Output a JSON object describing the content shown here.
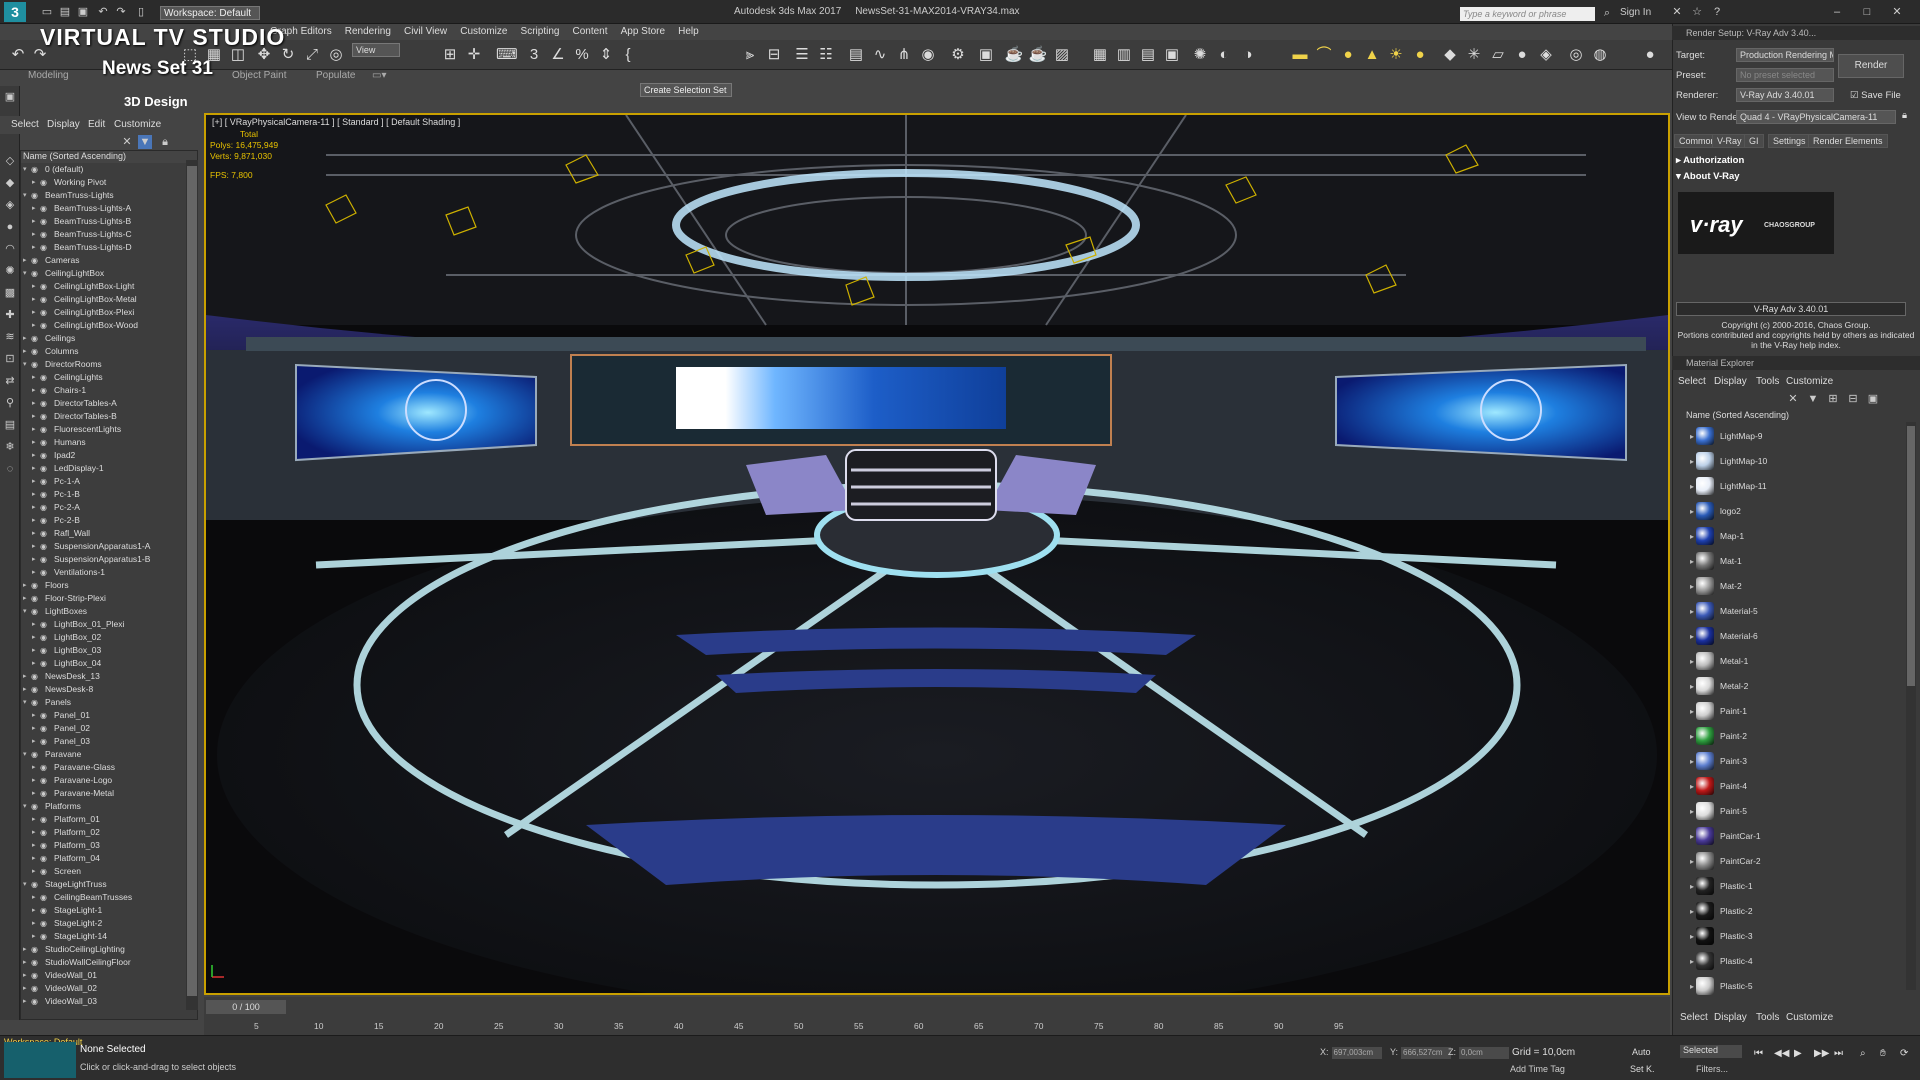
{
  "overlay": {
    "title": "VIRTUAL TV STUDIO",
    "subtitle": "News Set 31",
    "design_label": "3D Design"
  },
  "titlebar": {
    "workspace": "Workspace: Default",
    "app_title": "Autodesk 3ds Max 2017",
    "file_title": "NewsSet-31-MAX2014-VRAY34.max",
    "search_placeholder": "Type a keyword or phrase",
    "sign_in": "Sign In"
  },
  "menubar": [
    "Graph Editors",
    "Rendering",
    "Civil View",
    "Customize",
    "Scripting",
    "Content",
    "App Store",
    "Help"
  ],
  "toolbar": {
    "view_dropdown": "View",
    "selection_set": "Create Selection Set"
  },
  "ribbon_tabs": [
    "Modeling",
    "Object Paint",
    "Populate"
  ],
  "scene_explorer": {
    "menu": [
      "Select",
      "Display",
      "Edit",
      "Customize"
    ],
    "column_header": "Name (Sorted Ascending)",
    "items": [
      {
        "label": "0 (default)",
        "level": 0,
        "expanded": true
      },
      {
        "label": "Working Pivot",
        "level": 1,
        "expanded": false
      },
      {
        "label": "BeamTruss-Lights",
        "level": 0,
        "expanded": true
      },
      {
        "label": "BeamTruss-Lights-A",
        "level": 1,
        "expanded": false
      },
      {
        "label": "BeamTruss-Lights-B",
        "level": 1,
        "expanded": false
      },
      {
        "label": "BeamTruss-Lights-C",
        "level": 1,
        "expanded": false
      },
      {
        "label": "BeamTruss-Lights-D",
        "level": 1,
        "expanded": false
      },
      {
        "label": "Cameras",
        "level": 0,
        "expanded": false
      },
      {
        "label": "CeilingLightBox",
        "level": 0,
        "expanded": true
      },
      {
        "label": "CeilingLightBox-Light",
        "level": 1,
        "expanded": false
      },
      {
        "label": "CeilingLightBox-Metal",
        "level": 1,
        "expanded": false
      },
      {
        "label": "CeilingLightBox-Plexi",
        "level": 1,
        "expanded": false
      },
      {
        "label": "CeilingLightBox-Wood",
        "level": 1,
        "expanded": false
      },
      {
        "label": "Ceilings",
        "level": 0,
        "expanded": false
      },
      {
        "label": "Columns",
        "level": 0,
        "expanded": false
      },
      {
        "label": "DirectorRooms",
        "level": 0,
        "expanded": true
      },
      {
        "label": "CeilingLights",
        "level": 1,
        "expanded": false
      },
      {
        "label": "Chairs-1",
        "level": 1,
        "expanded": false
      },
      {
        "label": "DirectorTables-A",
        "level": 1,
        "expanded": false
      },
      {
        "label": "DirectorTables-B",
        "level": 1,
        "expanded": false
      },
      {
        "label": "FluorescentLights",
        "level": 1,
        "expanded": false
      },
      {
        "label": "Humans",
        "level": 1,
        "expanded": false
      },
      {
        "label": "Ipad2",
        "level": 1,
        "expanded": false
      },
      {
        "label": "LedDisplay-1",
        "level": 1,
        "expanded": false
      },
      {
        "label": "Pc-1-A",
        "level": 1,
        "expanded": false
      },
      {
        "label": "Pc-1-B",
        "level": 1,
        "expanded": false
      },
      {
        "label": "Pc-2-A",
        "level": 1,
        "expanded": false
      },
      {
        "label": "Pc-2-B",
        "level": 1,
        "expanded": false
      },
      {
        "label": "Rafl_Wall",
        "level": 1,
        "expanded": false
      },
      {
        "label": "SuspensionApparatus1-A",
        "level": 1,
        "expanded": false
      },
      {
        "label": "SuspensionApparatus1-B",
        "level": 1,
        "expanded": false
      },
      {
        "label": "Ventilations-1",
        "level": 1,
        "expanded": false
      },
      {
        "label": "Floors",
        "level": 0,
        "expanded": false
      },
      {
        "label": "Floor-Strip-Plexi",
        "level": 0,
        "expanded": false
      },
      {
        "label": "LightBoxes",
        "level": 0,
        "expanded": true
      },
      {
        "label": "LightBox_01_Plexi",
        "level": 1,
        "expanded": false
      },
      {
        "label": "LightBox_02",
        "level": 1,
        "expanded": false
      },
      {
        "label": "LightBox_03",
        "level": 1,
        "expanded": false
      },
      {
        "label": "LightBox_04",
        "level": 1,
        "expanded": false
      },
      {
        "label": "NewsDesk_13",
        "level": 0,
        "expanded": false
      },
      {
        "label": "NewsDesk-8",
        "level": 0,
        "expanded": false
      },
      {
        "label": "Panels",
        "level": 0,
        "expanded": true
      },
      {
        "label": "Panel_01",
        "level": 1,
        "expanded": false
      },
      {
        "label": "Panel_02",
        "level": 1,
        "expanded": false
      },
      {
        "label": "Panel_03",
        "level": 1,
        "expanded": false
      },
      {
        "label": "Paravane",
        "level": 0,
        "expanded": true
      },
      {
        "label": "Paravane-Glass",
        "level": 1,
        "expanded": false
      },
      {
        "label": "Paravane-Logo",
        "level": 1,
        "expanded": false
      },
      {
        "label": "Paravane-Metal",
        "level": 1,
        "expanded": false
      },
      {
        "label": "Platforms",
        "level": 0,
        "expanded": true
      },
      {
        "label": "Platform_01",
        "level": 1,
        "expanded": false
      },
      {
        "label": "Platform_02",
        "level": 1,
        "expanded": false
      },
      {
        "label": "Platform_03",
        "level": 1,
        "expanded": false
      },
      {
        "label": "Platform_04",
        "level": 1,
        "expanded": false
      },
      {
        "label": "Screen",
        "level": 1,
        "expanded": false
      },
      {
        "label": "StageLightTruss",
        "level": 0,
        "expanded": true
      },
      {
        "label": "CeilingBeamTrusses",
        "level": 1,
        "expanded": false
      },
      {
        "label": "StageLight-1",
        "level": 1,
        "expanded": false
      },
      {
        "label": "StageLight-2",
        "level": 1,
        "expanded": false
      },
      {
        "label": "StageLight-14",
        "level": 1,
        "expanded": false
      },
      {
        "label": "StudioCeilingLighting",
        "level": 0,
        "expanded": false
      },
      {
        "label": "StudioWallCeilingFloor",
        "level": 0,
        "expanded": false
      },
      {
        "label": "VideoWall_01",
        "level": 0,
        "expanded": false
      },
      {
        "label": "VideoWall_02",
        "level": 0,
        "expanded": false
      },
      {
        "label": "VideoWall_03",
        "level": 0,
        "expanded": false
      }
    ]
  },
  "viewport": {
    "label": "[+] [ VRayPhysicalCamera-11 ] [ Standard ] [ Default Shading ]",
    "stats_header": "Total",
    "polys_label": "Polys:",
    "polys_value": "16,475,949",
    "verts_label": "Verts:",
    "verts_value": "9,871,030",
    "fps_label": "FPS:",
    "fps_value": "7,800"
  },
  "timeline": {
    "slider": "0 / 100",
    "ticks": [
      "5",
      "10",
      "15",
      "20",
      "25",
      "30",
      "35",
      "40",
      "45",
      "50",
      "55",
      "60",
      "65",
      "70",
      "75",
      "80",
      "85",
      "90",
      "95"
    ]
  },
  "status": {
    "workspace": "Workspace: Default",
    "selection": "None Selected",
    "hint": "Click or click-and-drag to select objects",
    "x_label": "X:",
    "x_value": "697,003cm",
    "y_label": "Y:",
    "y_value": "666,527cm",
    "z_label": "Z:",
    "z_value": "0,0cm",
    "grid": "Grid = 10,0cm",
    "add_time_tag": "Add Time Tag",
    "auto": "Auto",
    "set_key": "Set K.",
    "selected": "Selected",
    "filters": "Filters..."
  },
  "render_setup": {
    "window_title": "Render Setup: V-Ray Adv 3.40...",
    "target_label": "Target:",
    "target_value": "Production Rendering Mode",
    "preset_label": "Preset:",
    "preset_value": "No preset selected",
    "renderer_label": "Renderer:",
    "renderer_value": "V-Ray Adv 3.40.01",
    "save_file": "Save File",
    "render_button": "Render",
    "view_label": "View to Render:",
    "view_value": "Quad 4 - VRayPhysicalCamera-11",
    "tabs": [
      "Common",
      "V-Ray",
      "GI",
      "Settings",
      "Render Elements"
    ],
    "rollout_authorization": "Authorization",
    "rollout_about": "About V-Ray",
    "vray_logo": "v·ray",
    "chaos_logo": "CHAOSGROUP",
    "version": "V-Ray Adv 3.40.01",
    "copyright": "Copyright (c) 2000-2016, Chaos Group.\nPortions contributed and copyrights held by others as indicated in the V-Ray help index."
  },
  "material_explorer": {
    "title": "Material Explorer",
    "menu": [
      "Select",
      "Display",
      "Tools",
      "Customize"
    ],
    "column_header": "Name (Sorted Ascending)",
    "items": [
      {
        "label": "LightMap-9",
        "color": "#3a6fd0"
      },
      {
        "label": "LightMap-10",
        "color": "#bcd0e8"
      },
      {
        "label": "LightMap-11",
        "color": "#e8eef8"
      },
      {
        "label": "logo2",
        "color": "#2a5bb8"
      },
      {
        "label": "Map-1",
        "color": "#1e40b0"
      },
      {
        "label": "Mat-1",
        "color": "#777777"
      },
      {
        "label": "Mat-2",
        "color": "#9a9a9a"
      },
      {
        "label": "Material-5",
        "color": "#3c5ab8"
      },
      {
        "label": "Material-6",
        "color": "#1a30a0"
      },
      {
        "label": "Metal-1",
        "color": "#bdbdbd"
      },
      {
        "label": "Metal-2",
        "color": "#d8d8d8"
      },
      {
        "label": "Paint-1",
        "color": "#cfcfcf"
      },
      {
        "label": "Paint-2",
        "color": "#2fa040"
      },
      {
        "label": "Paint-3",
        "color": "#5d7fd0"
      },
      {
        "label": "Paint-4",
        "color": "#c01818"
      },
      {
        "label": "Paint-5",
        "color": "#dddddd"
      },
      {
        "label": "PaintCar-1",
        "color": "#4a3a9a"
      },
      {
        "label": "PaintCar-2",
        "color": "#8a8a8a"
      },
      {
        "label": "Plastic-1",
        "color": "#222222"
      },
      {
        "label": "Plastic-2",
        "color": "#1a1a1a"
      },
      {
        "label": "Plastic-3",
        "color": "#111111"
      },
      {
        "label": "Plastic-4",
        "color": "#333333"
      },
      {
        "label": "Plastic-5",
        "color": "#cccccc"
      }
    ],
    "bottom_menu": [
      "Select",
      "Display",
      "Tools",
      "Customize"
    ]
  }
}
